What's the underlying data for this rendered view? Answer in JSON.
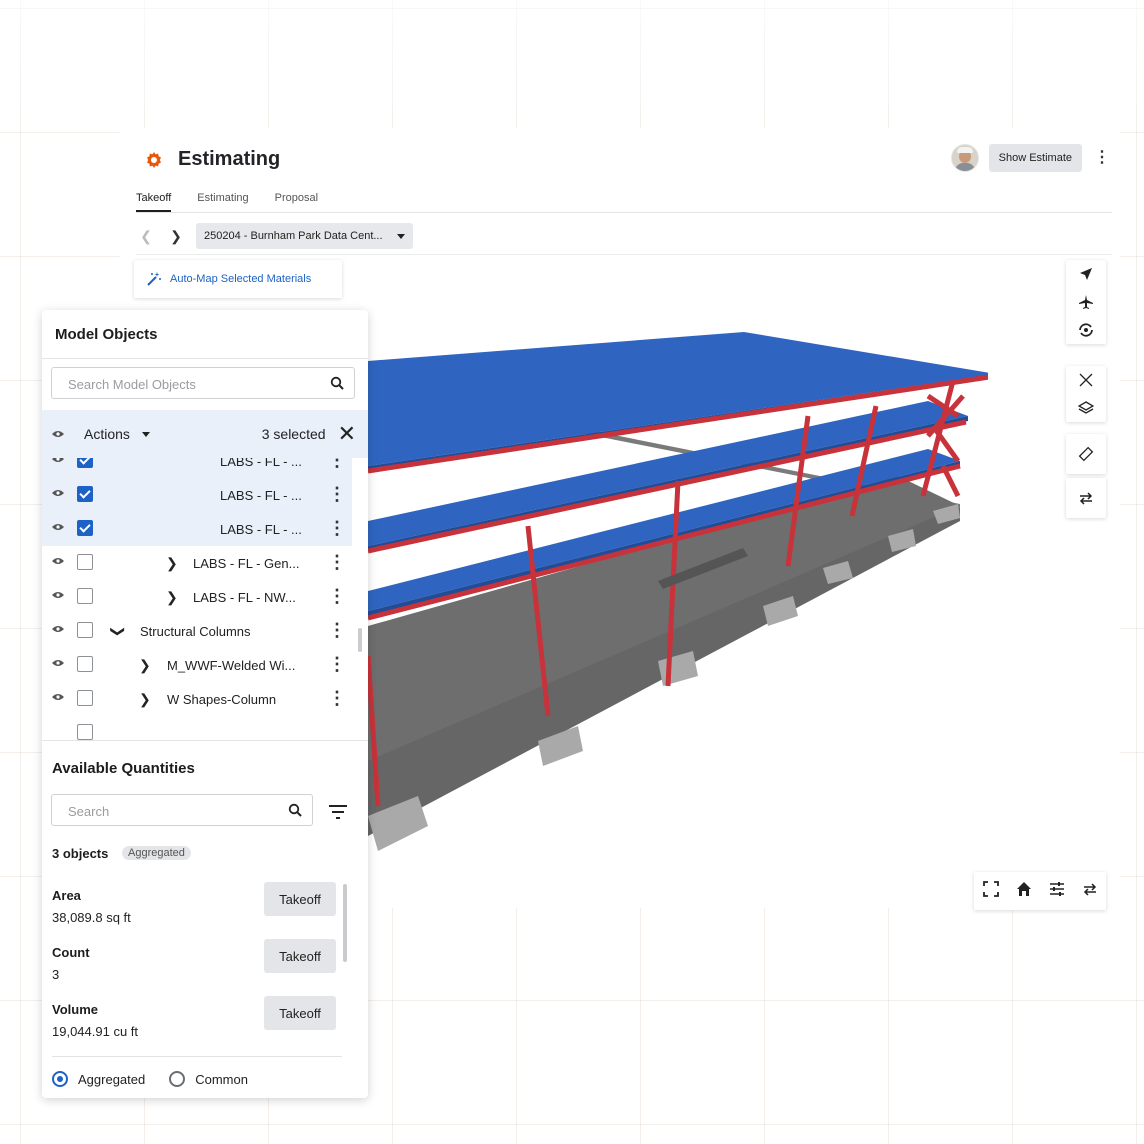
{
  "header": {
    "title": "Estimating",
    "show_estimate_label": "Show Estimate",
    "avatar": "user-avatar",
    "accent_color": "#e8580c"
  },
  "tabs": [
    {
      "label": "Takeoff",
      "active": true
    },
    {
      "label": "Estimating",
      "active": false
    },
    {
      "label": "Proposal",
      "active": false
    }
  ],
  "nav": {
    "project_label": "250204 - Burnham Park Data Cent..."
  },
  "automap": {
    "label": "Auto-Map Selected Materials"
  },
  "model_objects": {
    "title": "Model Objects",
    "search_placeholder": "Search Model Objects",
    "actions_label": "Actions",
    "selected_count": "3 selected",
    "rows": [
      {
        "label": "LABS - FL - ...",
        "checked": true,
        "expand": false
      },
      {
        "label": "LABS - FL - ...",
        "checked": true,
        "expand": false
      },
      {
        "label": "LABS - FL - ...",
        "checked": true,
        "expand": false
      },
      {
        "label": "LABS - FL - Gen...",
        "checked": false,
        "expand": true
      },
      {
        "label": "LABS - FL - NW...",
        "checked": false,
        "expand": true
      },
      {
        "label": "Structural Columns",
        "checked": false,
        "expand": "open"
      },
      {
        "label": "M_WWF-Welded Wi...",
        "checked": false,
        "expand": true
      },
      {
        "label": "W Shapes-Column",
        "checked": false,
        "expand": true
      }
    ]
  },
  "available_quantities": {
    "title": "Available Quantities",
    "search_placeholder": "Search",
    "object_count": "3 objects",
    "badge": "Aggregated",
    "takeoff_label": "Takeoff",
    "items": [
      {
        "name": "Area",
        "value": "38,089.8 sq ft"
      },
      {
        "name": "Count",
        "value": "3"
      },
      {
        "name": "Volume",
        "value": "19,044.91 cu ft"
      }
    ],
    "mode_options": [
      "Aggregated",
      "Common"
    ],
    "mode_selected": "Aggregated"
  },
  "colors": {
    "accent": "#e8580c",
    "link": "#1d62c4",
    "selection": "#e9f0fa",
    "slab": "#2f65c0",
    "beam": "#c8323a",
    "ground": "#6e6e6e"
  }
}
